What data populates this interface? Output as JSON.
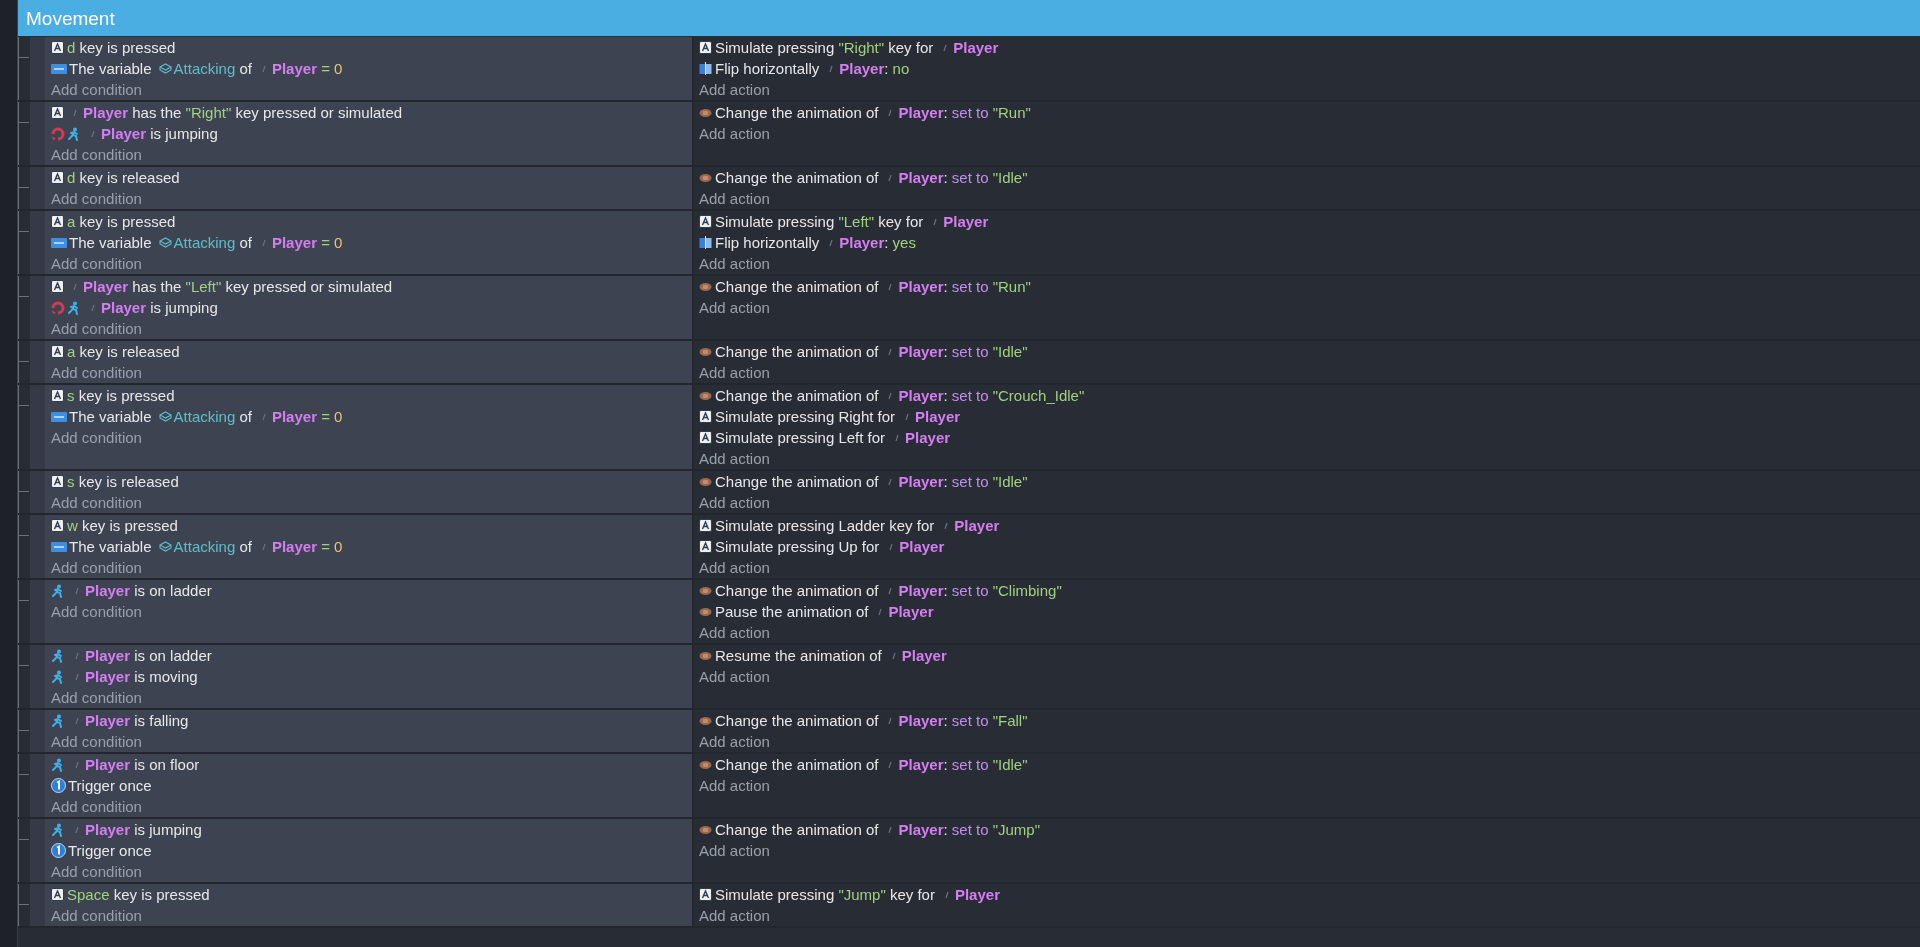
{
  "group": {
    "title": "Movement"
  },
  "events": [
    {
      "conditions": [
        {
          "kind": "keyboard",
          "parts": [
            {
              "kind": "string",
              "text": "d"
            },
            {
              "kind": "plain",
              "text": "key is pressed"
            }
          ]
        },
        {
          "kind": "variable",
          "parts": [
            {
              "kind": "plain",
              "text": "The variable"
            },
            {
              "kind": "variable",
              "text": "Attacking"
            },
            {
              "kind": "plain",
              "text": "of"
            },
            {
              "kind": "object",
              "text": "Player"
            },
            {
              "kind": "operator",
              "text": "="
            },
            {
              "kind": "number",
              "text": "0"
            }
          ]
        }
      ],
      "add_condition": "Add condition",
      "actions": [
        {
          "kind": "keyboard",
          "parts": [
            {
              "kind": "plain",
              "text": "Simulate pressing"
            },
            {
              "kind": "string",
              "text": "\"Right\""
            },
            {
              "kind": "plain",
              "text": "key for"
            },
            {
              "kind": "object",
              "text": "Player"
            }
          ]
        },
        {
          "kind": "flip",
          "parts": [
            {
              "kind": "plain",
              "text": "Flip horizontally"
            },
            {
              "kind": "object",
              "text": "Player"
            },
            {
              "kind": "punct",
              "text": ":"
            },
            {
              "kind": "string",
              "text": "no"
            }
          ]
        }
      ],
      "add_action": "Add action"
    },
    {
      "conditions": [
        {
          "kind": "keyboard",
          "parts": [
            {
              "kind": "object",
              "text": "Player"
            },
            {
              "kind": "plain",
              "text": "has the"
            },
            {
              "kind": "string",
              "text": "\"Right\""
            },
            {
              "kind": "plain",
              "text": "key pressed or simulated"
            }
          ]
        },
        {
          "kind": "inverted-platformer",
          "parts": [
            {
              "kind": "object",
              "text": "Player"
            },
            {
              "kind": "plain",
              "text": "is jumping"
            }
          ]
        }
      ],
      "add_condition": "Add condition",
      "actions": [
        {
          "kind": "sprite",
          "parts": [
            {
              "kind": "plain",
              "text": "Change the animation of"
            },
            {
              "kind": "object",
              "text": "Player"
            },
            {
              "kind": "punct",
              "text": ":"
            },
            {
              "kind": "keyword",
              "text": "set to"
            },
            {
              "kind": "string",
              "text": "\"Run\""
            }
          ]
        }
      ],
      "add_action": "Add action"
    },
    {
      "conditions": [
        {
          "kind": "keyboard",
          "parts": [
            {
              "kind": "string",
              "text": "d"
            },
            {
              "kind": "plain",
              "text": "key is released"
            }
          ]
        }
      ],
      "add_condition": "Add condition",
      "actions": [
        {
          "kind": "sprite",
          "parts": [
            {
              "kind": "plain",
              "text": "Change the animation of"
            },
            {
              "kind": "object",
              "text": "Player"
            },
            {
              "kind": "punct",
              "text": ":"
            },
            {
              "kind": "keyword",
              "text": "set to"
            },
            {
              "kind": "string",
              "text": "\"Idle\""
            }
          ]
        }
      ],
      "add_action": "Add action"
    },
    {
      "conditions": [
        {
          "kind": "keyboard",
          "parts": [
            {
              "kind": "string",
              "text": "a"
            },
            {
              "kind": "plain",
              "text": "key is pressed"
            }
          ]
        },
        {
          "kind": "variable",
          "parts": [
            {
              "kind": "plain",
              "text": "The variable"
            },
            {
              "kind": "variable",
              "text": "Attacking"
            },
            {
              "kind": "plain",
              "text": "of"
            },
            {
              "kind": "object",
              "text": "Player"
            },
            {
              "kind": "operator",
              "text": "="
            },
            {
              "kind": "number",
              "text": "0"
            }
          ]
        }
      ],
      "add_condition": "Add condition",
      "actions": [
        {
          "kind": "keyboard",
          "parts": [
            {
              "kind": "plain",
              "text": "Simulate pressing"
            },
            {
              "kind": "string",
              "text": "\"Left\""
            },
            {
              "kind": "plain",
              "text": "key for"
            },
            {
              "kind": "object",
              "text": "Player"
            }
          ]
        },
        {
          "kind": "flip",
          "parts": [
            {
              "kind": "plain",
              "text": "Flip horizontally"
            },
            {
              "kind": "object",
              "text": "Player"
            },
            {
              "kind": "punct",
              "text": ":"
            },
            {
              "kind": "string",
              "text": "yes"
            }
          ]
        }
      ],
      "add_action": "Add action"
    },
    {
      "conditions": [
        {
          "kind": "keyboard",
          "parts": [
            {
              "kind": "object",
              "text": "Player"
            },
            {
              "kind": "plain",
              "text": "has the"
            },
            {
              "kind": "string",
              "text": "\"Left\""
            },
            {
              "kind": "plain",
              "text": "key pressed or simulated"
            }
          ]
        },
        {
          "kind": "inverted-platformer",
          "parts": [
            {
              "kind": "object",
              "text": "Player"
            },
            {
              "kind": "plain",
              "text": "is jumping"
            }
          ]
        }
      ],
      "add_condition": "Add condition",
      "actions": [
        {
          "kind": "sprite",
          "parts": [
            {
              "kind": "plain",
              "text": "Change the animation of"
            },
            {
              "kind": "object",
              "text": "Player"
            },
            {
              "kind": "punct",
              "text": ":"
            },
            {
              "kind": "keyword",
              "text": "set to"
            },
            {
              "kind": "string",
              "text": "\"Run\""
            }
          ]
        }
      ],
      "add_action": "Add action"
    },
    {
      "conditions": [
        {
          "kind": "keyboard",
          "parts": [
            {
              "kind": "string",
              "text": "a"
            },
            {
              "kind": "plain",
              "text": "key is released"
            }
          ]
        }
      ],
      "add_condition": "Add condition",
      "actions": [
        {
          "kind": "sprite",
          "parts": [
            {
              "kind": "plain",
              "text": "Change the animation of"
            },
            {
              "kind": "object",
              "text": "Player"
            },
            {
              "kind": "punct",
              "text": ":"
            },
            {
              "kind": "keyword",
              "text": "set to"
            },
            {
              "kind": "string",
              "text": "\"Idle\""
            }
          ]
        }
      ],
      "add_action": "Add action"
    },
    {
      "conditions": [
        {
          "kind": "keyboard",
          "parts": [
            {
              "kind": "string",
              "text": "s"
            },
            {
              "kind": "plain",
              "text": "key is pressed"
            }
          ]
        },
        {
          "kind": "variable",
          "parts": [
            {
              "kind": "plain",
              "text": "The variable"
            },
            {
              "kind": "variable",
              "text": "Attacking"
            },
            {
              "kind": "plain",
              "text": "of"
            },
            {
              "kind": "object",
              "text": "Player"
            },
            {
              "kind": "operator",
              "text": "="
            },
            {
              "kind": "number",
              "text": "0"
            }
          ]
        }
      ],
      "add_condition": "Add condition",
      "actions": [
        {
          "kind": "sprite",
          "parts": [
            {
              "kind": "plain",
              "text": "Change the animation of"
            },
            {
              "kind": "object",
              "text": "Player"
            },
            {
              "kind": "punct",
              "text": ":"
            },
            {
              "kind": "keyword",
              "text": "set to"
            },
            {
              "kind": "string",
              "text": "\"Crouch_Idle\""
            }
          ]
        },
        {
          "kind": "keyboard",
          "parts": [
            {
              "kind": "plain",
              "text": "Simulate pressing Right for"
            },
            {
              "kind": "object",
              "text": "Player"
            }
          ]
        },
        {
          "kind": "keyboard",
          "parts": [
            {
              "kind": "plain",
              "text": "Simulate pressing Left for"
            },
            {
              "kind": "object",
              "text": "Player"
            }
          ]
        }
      ],
      "add_action": "Add action"
    },
    {
      "conditions": [
        {
          "kind": "keyboard",
          "parts": [
            {
              "kind": "string",
              "text": "s"
            },
            {
              "kind": "plain",
              "text": "key is released"
            }
          ]
        }
      ],
      "add_condition": "Add condition",
      "actions": [
        {
          "kind": "sprite",
          "parts": [
            {
              "kind": "plain",
              "text": "Change the animation of"
            },
            {
              "kind": "object",
              "text": "Player"
            },
            {
              "kind": "punct",
              "text": ":"
            },
            {
              "kind": "keyword",
              "text": "set to"
            },
            {
              "kind": "string",
              "text": "\"Idle\""
            }
          ]
        }
      ],
      "add_action": "Add action"
    },
    {
      "conditions": [
        {
          "kind": "keyboard",
          "parts": [
            {
              "kind": "string",
              "text": "w"
            },
            {
              "kind": "plain",
              "text": "key is pressed"
            }
          ]
        },
        {
          "kind": "variable",
          "parts": [
            {
              "kind": "plain",
              "text": "The variable"
            },
            {
              "kind": "variable",
              "text": "Attacking"
            },
            {
              "kind": "plain",
              "text": "of"
            },
            {
              "kind": "object",
              "text": "Player"
            },
            {
              "kind": "operator",
              "text": "="
            },
            {
              "kind": "number",
              "text": "0"
            }
          ]
        }
      ],
      "add_condition": "Add condition",
      "actions": [
        {
          "kind": "keyboard",
          "parts": [
            {
              "kind": "plain",
              "text": "Simulate pressing Ladder key for"
            },
            {
              "kind": "object",
              "text": "Player"
            }
          ]
        },
        {
          "kind": "keyboard",
          "parts": [
            {
              "kind": "plain",
              "text": "Simulate pressing Up for"
            },
            {
              "kind": "object",
              "text": "Player"
            }
          ]
        }
      ],
      "add_action": "Add action"
    },
    {
      "conditions": [
        {
          "kind": "platformer",
          "parts": [
            {
              "kind": "object",
              "text": "Player"
            },
            {
              "kind": "plain",
              "text": "is on ladder"
            }
          ]
        }
      ],
      "add_condition": "Add condition",
      "actions": [
        {
          "kind": "sprite",
          "parts": [
            {
              "kind": "plain",
              "text": "Change the animation of"
            },
            {
              "kind": "object",
              "text": "Player"
            },
            {
              "kind": "punct",
              "text": ":"
            },
            {
              "kind": "keyword",
              "text": "set to"
            },
            {
              "kind": "string",
              "text": "\"Climbing\""
            }
          ]
        },
        {
          "kind": "sprite",
          "parts": [
            {
              "kind": "plain",
              "text": "Pause the animation of"
            },
            {
              "kind": "object",
              "text": "Player"
            }
          ]
        }
      ],
      "add_action": "Add action"
    },
    {
      "conditions": [
        {
          "kind": "platformer",
          "parts": [
            {
              "kind": "object",
              "text": "Player"
            },
            {
              "kind": "plain",
              "text": "is on ladder"
            }
          ]
        },
        {
          "kind": "platformer",
          "parts": [
            {
              "kind": "object",
              "text": "Player"
            },
            {
              "kind": "plain",
              "text": "is moving"
            }
          ]
        }
      ],
      "add_condition": "Add condition",
      "actions": [
        {
          "kind": "sprite",
          "parts": [
            {
              "kind": "plain",
              "text": "Resume the animation of"
            },
            {
              "kind": "object",
              "text": "Player"
            }
          ]
        }
      ],
      "add_action": "Add action"
    },
    {
      "conditions": [
        {
          "kind": "platformer",
          "parts": [
            {
              "kind": "object",
              "text": "Player"
            },
            {
              "kind": "plain",
              "text": "is falling"
            }
          ]
        }
      ],
      "add_condition": "Add condition",
      "actions": [
        {
          "kind": "sprite",
          "parts": [
            {
              "kind": "plain",
              "text": "Change the animation of"
            },
            {
              "kind": "object",
              "text": "Player"
            },
            {
              "kind": "punct",
              "text": ":"
            },
            {
              "kind": "keyword",
              "text": "set to"
            },
            {
              "kind": "string",
              "text": "\"Fall\""
            }
          ]
        }
      ],
      "add_action": "Add action"
    },
    {
      "conditions": [
        {
          "kind": "platformer",
          "parts": [
            {
              "kind": "object",
              "text": "Player"
            },
            {
              "kind": "plain",
              "text": "is on floor"
            }
          ]
        },
        {
          "kind": "trigger",
          "parts": [
            {
              "kind": "plain",
              "text": "Trigger once"
            }
          ]
        }
      ],
      "add_condition": "Add condition",
      "actions": [
        {
          "kind": "sprite",
          "parts": [
            {
              "kind": "plain",
              "text": "Change the animation of"
            },
            {
              "kind": "object",
              "text": "Player"
            },
            {
              "kind": "punct",
              "text": ":"
            },
            {
              "kind": "keyword",
              "text": "set to"
            },
            {
              "kind": "string",
              "text": "\"Idle\""
            }
          ]
        }
      ],
      "add_action": "Add action"
    },
    {
      "conditions": [
        {
          "kind": "platformer",
          "parts": [
            {
              "kind": "object",
              "text": "Player"
            },
            {
              "kind": "plain",
              "text": "is jumping"
            }
          ]
        },
        {
          "kind": "trigger",
          "parts": [
            {
              "kind": "plain",
              "text": "Trigger once"
            }
          ]
        }
      ],
      "add_condition": "Add condition",
      "actions": [
        {
          "kind": "sprite",
          "parts": [
            {
              "kind": "plain",
              "text": "Change the animation of"
            },
            {
              "kind": "object",
              "text": "Player"
            },
            {
              "kind": "punct",
              "text": ":"
            },
            {
              "kind": "keyword",
              "text": "set to"
            },
            {
              "kind": "string",
              "text": "\"Jump\""
            }
          ]
        }
      ],
      "add_action": "Add action"
    },
    {
      "conditions": [
        {
          "kind": "keyboard",
          "parts": [
            {
              "kind": "string",
              "text": "Space"
            },
            {
              "kind": "plain",
              "text": "key is pressed"
            }
          ]
        }
      ],
      "add_condition": "Add condition",
      "actions": [
        {
          "kind": "keyboard",
          "parts": [
            {
              "kind": "plain",
              "text": "Simulate pressing"
            },
            {
              "kind": "string",
              "text": "\"Jump\""
            },
            {
              "kind": "plain",
              "text": "key for"
            },
            {
              "kind": "object",
              "text": "Player"
            }
          ]
        }
      ],
      "add_action": "Add action"
    }
  ]
}
